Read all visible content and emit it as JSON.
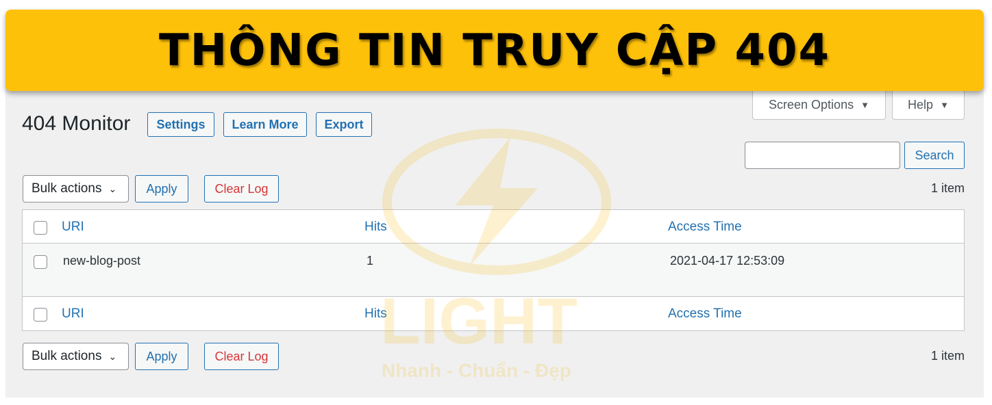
{
  "banner": {
    "title": "THÔNG TIN TRUY CẬP 404"
  },
  "watermark": {
    "brand": "LIGHT",
    "slogan": "Nhanh - Chuẩn - Đẹp"
  },
  "header": {
    "title": "404 Monitor",
    "buttons": {
      "settings": "Settings",
      "learn_more": "Learn More",
      "export": "Export"
    }
  },
  "screen_options": {
    "label": "Screen Options",
    "help": "Help",
    "arrow": "▼"
  },
  "search": {
    "value": "",
    "button": "Search"
  },
  "bulk": {
    "select": "Bulk actions",
    "apply": "Apply",
    "clear": "Clear Log",
    "count": "1 item"
  },
  "table": {
    "columns": [
      "URI",
      "Hits",
      "Access Time"
    ],
    "rows": [
      {
        "uri": "new-blog-post",
        "hits": "1",
        "time": "2021-04-17 12:53:09"
      }
    ]
  },
  "colors": {
    "accent": "#2271b1",
    "danger": "#d63638",
    "banner": "#fec10a"
  }
}
